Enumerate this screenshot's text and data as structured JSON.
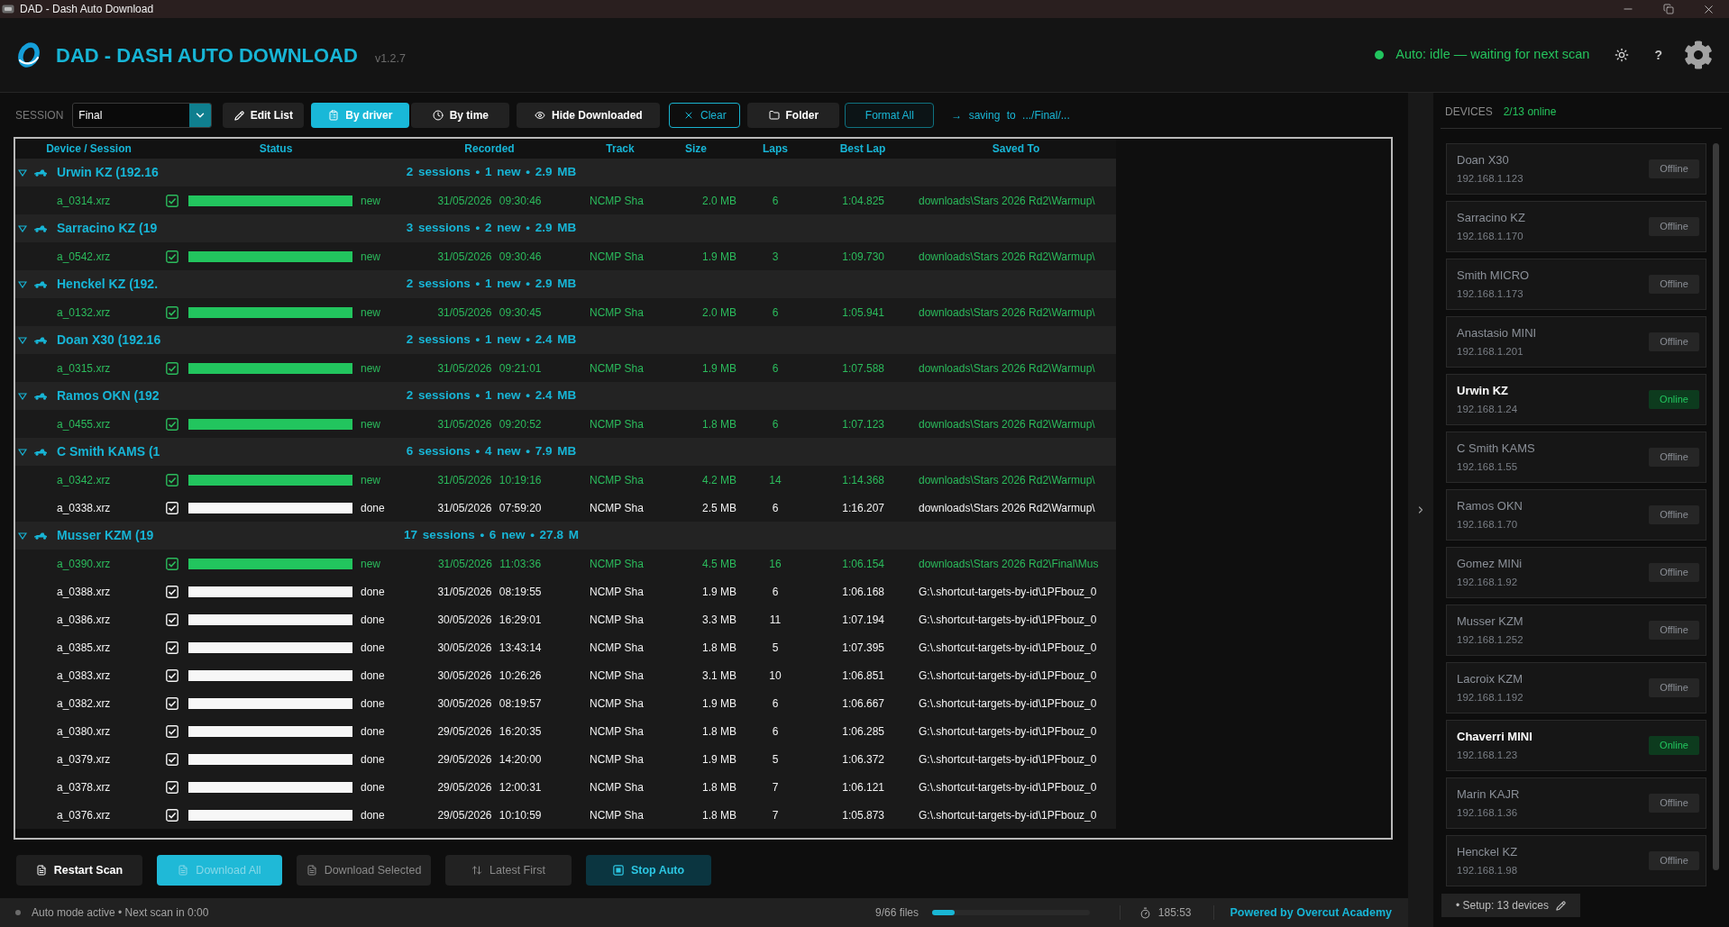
{
  "window": {
    "title": "DAD - Dash Auto Download"
  },
  "header": {
    "title": "DAD - DASH AUTO DOWNLOAD",
    "version": "v1.2.7",
    "status": "Auto: idle — waiting for next scan",
    "help": "?"
  },
  "toolbar": {
    "session_label": "SESSION",
    "session_value": "Final",
    "edit_button": "Edit List",
    "view_modes": [
      {
        "label": "By driver",
        "selected": true
      },
      {
        "label": "By time",
        "selected": false
      }
    ],
    "actions": [
      {
        "label": "Hide Downloaded",
        "kind": "plain"
      },
      {
        "label": "Clear",
        "kind": "outline"
      },
      {
        "label": "Folder",
        "kind": "plain"
      },
      {
        "label": "Format All",
        "kind": "outline_dim"
      }
    ],
    "saving_hint": "→ saving to .../Final/..."
  },
  "table": {
    "columns": [
      "Device / Session",
      "Status",
      "Recorded",
      "Track",
      "Size",
      "Laps",
      "Best Lap",
      "Saved To"
    ],
    "groups": [
      {
        "name": "Urwin KZ (192.16",
        "summary": "2 sessions • 1 new • 2.9 MB",
        "expanded": true,
        "children": [
          {
            "name": "a_0314.xrz",
            "checked": true,
            "kind": "new",
            "level": 1,
            "status": "new",
            "recorded": "31/05/2026 09:30:46",
            "track": "NCMP Sha",
            "size": "2.0 MB",
            "laps": "6",
            "best_lap": "1:04.825",
            "saved_to": "downloads\\Stars 2026 Rd2\\Warmup\\"
          }
        ]
      },
      {
        "name": "Sarracino KZ (19",
        "summary": "3 sessions • 2 new • 2.9 MB",
        "expanded": true,
        "children": [
          {
            "name": "a_0542.xrz",
            "checked": true,
            "kind": "new",
            "level": 1,
            "status": "new",
            "recorded": "31/05/2026 09:30:46",
            "track": "NCMP Sha",
            "size": "1.9 MB",
            "laps": "3",
            "best_lap": "1:09.730",
            "saved_to": "downloads\\Stars 2026 Rd2\\Warmup\\"
          }
        ]
      },
      {
        "name": "Henckel KZ (192.",
        "summary": "2 sessions • 1 new • 2.9 MB",
        "expanded": true,
        "children": [
          {
            "name": "a_0132.xrz",
            "checked": true,
            "kind": "new",
            "level": 1,
            "status": "new",
            "recorded": "31/05/2026 09:30:45",
            "track": "NCMP Sha",
            "size": "2.0 MB",
            "laps": "6",
            "best_lap": "1:05.941",
            "saved_to": "downloads\\Stars 2026 Rd2\\Warmup\\"
          }
        ]
      },
      {
        "name": "Doan X30 (192.16",
        "summary": "2 sessions • 1 new • 2.4 MB",
        "expanded": true,
        "children": [
          {
            "name": "a_0315.xrz",
            "checked": true,
            "kind": "new",
            "level": 1,
            "status": "new",
            "recorded": "31/05/2026 09:21:01",
            "track": "NCMP Sha",
            "size": "1.9 MB",
            "laps": "6",
            "best_lap": "1:07.588",
            "saved_to": "downloads\\Stars 2026 Rd2\\Warmup\\"
          }
        ]
      },
      {
        "name": "Ramos OKN (192",
        "summary": "2 sessions • 1 new • 2.4 MB",
        "expanded": true,
        "children": [
          {
            "name": "a_0455.xrz",
            "checked": true,
            "kind": "new",
            "level": 1,
            "status": "new",
            "recorded": "31/05/2026 09:20:52",
            "track": "NCMP Sha",
            "size": "1.8 MB",
            "laps": "6",
            "best_lap": "1:07.123",
            "saved_to": "downloads\\Stars 2026 Rd2\\Warmup\\"
          }
        ]
      },
      {
        "name": "C Smith KAMS (1",
        "summary": "6 sessions • 4 new • 7.9 MB",
        "expanded": true,
        "children": [
          {
            "name": "a_0342.xrz",
            "checked": true,
            "kind": "new",
            "level": 1,
            "status": "new",
            "recorded": "31/05/2026 10:19:16",
            "track": "NCMP Sha",
            "size": "4.2 MB",
            "laps": "14",
            "best_lap": "1:14.368",
            "saved_to": "downloads\\Stars 2026 Rd2\\Warmup\\"
          },
          {
            "name": "a_0338.xrz",
            "checked": true,
            "kind": "done",
            "level": 1,
            "status": "done",
            "recorded": "31/05/2026 07:59:20",
            "track": "NCMP Sha",
            "size": "2.5 MB",
            "laps": "6",
            "best_lap": "1:16.207",
            "saved_to": "downloads\\Stars 2026 Rd2\\Warmup\\"
          }
        ]
      },
      {
        "name": "Musser KZM (19",
        "summary": "17 sessions • 6 new • 27.8 M",
        "expanded": true,
        "children": [
          {
            "name": "a_0390.xrz",
            "checked": true,
            "kind": "new",
            "level": 1,
            "status": "new",
            "recorded": "31/05/2026 11:03:36",
            "track": "NCMP Sha",
            "size": "4.5 MB",
            "laps": "16",
            "best_lap": "1:06.154",
            "saved_to": "downloads\\Stars 2026 Rd2\\Final\\Mus"
          },
          {
            "name": "a_0388.xrz",
            "checked": true,
            "kind": "done",
            "level": 1,
            "status": "done",
            "recorded": "31/05/2026 08:19:55",
            "track": "NCMP Sha",
            "size": "1.9 MB",
            "laps": "6",
            "best_lap": "1:06.168",
            "saved_to": "G:\\.shortcut-targets-by-id\\1PFbouz_0"
          },
          {
            "name": "a_0386.xrz",
            "checked": true,
            "kind": "done",
            "level": 1,
            "status": "done",
            "recorded": "30/05/2026 16:29:01",
            "track": "NCMP Sha",
            "size": "3.3 MB",
            "laps": "11",
            "best_lap": "1:07.194",
            "saved_to": "G:\\.shortcut-targets-by-id\\1PFbouz_0"
          },
          {
            "name": "a_0385.xrz",
            "checked": true,
            "kind": "done",
            "level": 1,
            "status": "done",
            "recorded": "30/05/2026 13:43:14",
            "track": "NCMP Sha",
            "size": "1.8 MB",
            "laps": "5",
            "best_lap": "1:07.395",
            "saved_to": "G:\\.shortcut-targets-by-id\\1PFbouz_0"
          },
          {
            "name": "a_0383.xrz",
            "checked": true,
            "kind": "done",
            "level": 1,
            "status": "done",
            "recorded": "30/05/2026 10:26:26",
            "track": "NCMP Sha",
            "size": "3.1 MB",
            "laps": "10",
            "best_lap": "1:06.851",
            "saved_to": "G:\\.shortcut-targets-by-id\\1PFbouz_0"
          },
          {
            "name": "a_0382.xrz",
            "checked": true,
            "kind": "done",
            "level": 1,
            "status": "done",
            "recorded": "30/05/2026 08:19:57",
            "track": "NCMP Sha",
            "size": "1.9 MB",
            "laps": "6",
            "best_lap": "1:06.667",
            "saved_to": "G:\\.shortcut-targets-by-id\\1PFbouz_0"
          },
          {
            "name": "a_0380.xrz",
            "checked": true,
            "kind": "done",
            "level": 1,
            "status": "done",
            "recorded": "29/05/2026 16:20:35",
            "track": "NCMP Sha",
            "size": "1.8 MB",
            "laps": "6",
            "best_lap": "1:06.285",
            "saved_to": "G:\\.shortcut-targets-by-id\\1PFbouz_0"
          },
          {
            "name": "a_0379.xrz",
            "checked": true,
            "kind": "done",
            "level": 1,
            "status": "done",
            "recorded": "29/05/2026 14:20:00",
            "track": "NCMP Sha",
            "size": "1.9 MB",
            "laps": "5",
            "best_lap": "1:06.372",
            "saved_to": "G:\\.shortcut-targets-by-id\\1PFbouz_0"
          },
          {
            "name": "a_0378.xrz",
            "checked": true,
            "kind": "done",
            "level": 1,
            "status": "done",
            "recorded": "29/05/2026 12:00:31",
            "track": "NCMP Sha",
            "size": "1.8 MB",
            "laps": "7",
            "best_lap": "1:06.121",
            "saved_to": "G:\\.shortcut-targets-by-id\\1PFbouz_0"
          },
          {
            "name": "a_0376.xrz",
            "checked": true,
            "kind": "done",
            "level": 1,
            "status": "done",
            "recorded": "29/05/2026 10:10:59",
            "track": "NCMP Sha",
            "size": "1.8 MB",
            "laps": "7",
            "best_lap": "1:05.873",
            "saved_to": "G:\\.shortcut-targets-by-id\\1PFbouz_0"
          }
        ]
      }
    ]
  },
  "bottom_buttons": [
    {
      "label": "Restart Scan",
      "kind": "default",
      "disabled": false
    },
    {
      "label": "Download All",
      "kind": "primary",
      "disabled": true
    },
    {
      "label": "Download Selected",
      "kind": "default",
      "disabled": true
    },
    {
      "label": "Latest First",
      "kind": "default",
      "disabled": true
    },
    {
      "label": "Stop Auto",
      "kind": "accent",
      "disabled": false
    }
  ],
  "status_bar": {
    "mode": "Auto mode active • Next scan in 0:00",
    "files": "9/66 files",
    "level": 0.14,
    "elapsed": "185:53",
    "credit": "Powered by Overcut Academy"
  },
  "devices_panel": {
    "title": "DEVICES",
    "online_count": "2/13 online",
    "devices": [
      {
        "name": "Doan X30",
        "ip": "192.168.1.123",
        "status": "Offline",
        "online": false
      },
      {
        "name": "Sarracino KZ",
        "ip": "192.168.1.170",
        "status": "Offline",
        "online": false
      },
      {
        "name": "Smith MICRO",
        "ip": "192.168.1.173",
        "status": "Offline",
        "online": false
      },
      {
        "name": "Anastasio MINI",
        "ip": "192.168.1.201",
        "status": "Offline",
        "online": false
      },
      {
        "name": "Urwin KZ",
        "ip": "192.168.1.24",
        "status": "Online",
        "online": true
      },
      {
        "name": "C Smith KAMS",
        "ip": "192.168.1.55",
        "status": "Offline",
        "online": false
      },
      {
        "name": "Ramos OKN",
        "ip": "192.168.1.70",
        "status": "Offline",
        "online": false
      },
      {
        "name": "Gomez MINi",
        "ip": "192.168.1.92",
        "status": "Offline",
        "online": false
      },
      {
        "name": "Musser KZM",
        "ip": "192.168.1.252",
        "status": "Offline",
        "online": false
      },
      {
        "name": "Lacroix KZM",
        "ip": "192.168.1.192",
        "status": "Offline",
        "online": false
      },
      {
        "name": "Chaverri MINI",
        "ip": "192.168.1.23",
        "status": "Online",
        "online": true
      },
      {
        "name": "Marin KAJR",
        "ip": "192.168.1.36",
        "status": "Offline",
        "online": false
      },
      {
        "name": "Henckel KZ",
        "ip": "192.168.1.98",
        "status": "Offline",
        "online": false
      }
    ],
    "setup_button": "• Setup: 13 devices"
  }
}
